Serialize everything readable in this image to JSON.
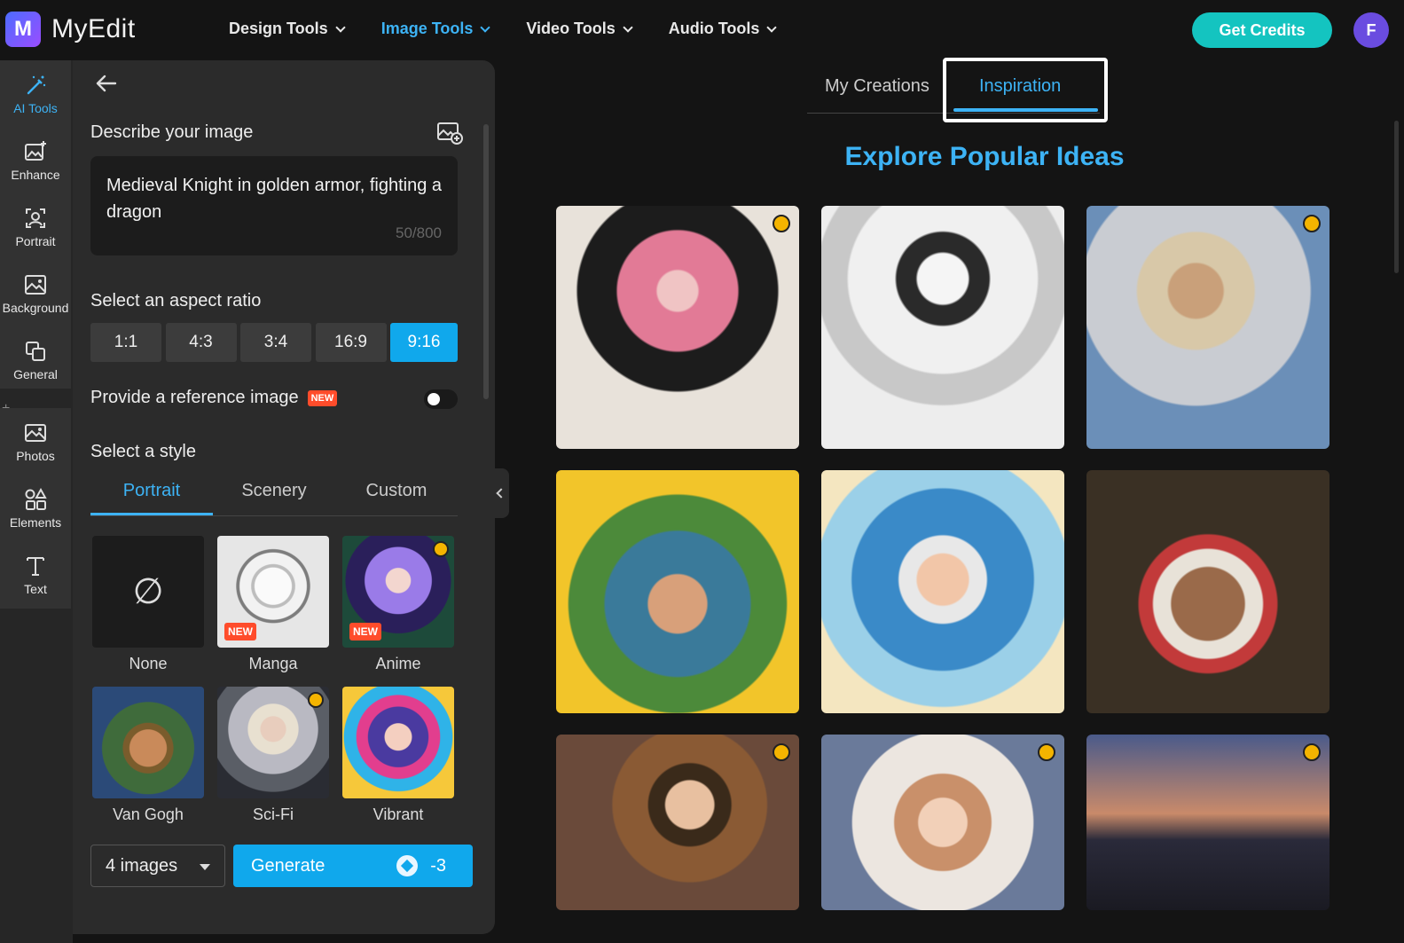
{
  "app": {
    "logo_letter": "M",
    "name": "MyEdit"
  },
  "nav": [
    {
      "label": "Design Tools",
      "active": false
    },
    {
      "label": "Image Tools",
      "active": true
    },
    {
      "label": "Video Tools",
      "active": false
    },
    {
      "label": "Audio Tools",
      "active": false
    }
  ],
  "header": {
    "credits_label": "Get Credits",
    "avatar_letter": "F"
  },
  "rail": {
    "items": [
      {
        "label": "AI Tools",
        "icon": "magic-wand-icon"
      },
      {
        "label": "Enhance",
        "icon": "enhance-icon"
      },
      {
        "label": "Portrait",
        "icon": "portrait-icon"
      },
      {
        "label": "Background",
        "icon": "background-icon"
      },
      {
        "label": "General",
        "icon": "general-icon"
      },
      {
        "label": "Photos",
        "icon": "photos-icon"
      },
      {
        "label": "Elements",
        "icon": "elements-icon"
      },
      {
        "label": "Text",
        "icon": "text-icon"
      }
    ],
    "plus": "+"
  },
  "panel": {
    "describe_label": "Describe your image",
    "prompt": "Medieval Knight in golden armor, fighting a dragon",
    "char_count": "50/800",
    "aspect_label": "Select an aspect ratio",
    "ratios": [
      "1:1",
      "4:3",
      "3:4",
      "16:9",
      "9:16"
    ],
    "selected_ratio": "9:16",
    "reference_label": "Provide a reference image",
    "new_badge": "NEW",
    "style_label": "Select a style",
    "style_tabs": [
      "Portrait",
      "Scenery",
      "Custom"
    ],
    "none_symbol": "∅",
    "styles": [
      {
        "name": "None"
      },
      {
        "name": "Manga",
        "badge": "NEW"
      },
      {
        "name": "Anime",
        "badge": "NEW"
      },
      {
        "name": "Van Gogh"
      },
      {
        "name": "Sci-Fi"
      },
      {
        "name": "Vibrant"
      }
    ],
    "image_count": "4 images",
    "generate_label": "Generate",
    "generate_cost": "-3"
  },
  "main": {
    "tabs": [
      "My Creations",
      "Inspiration"
    ],
    "active_tab": "Inspiration",
    "explore_title": "Explore Popular Ideas"
  },
  "colors": {
    "accent": "#3db3f5",
    "button": "#10a8ec",
    "credits": "#14c4c0",
    "badge": "#ff4c2b"
  }
}
